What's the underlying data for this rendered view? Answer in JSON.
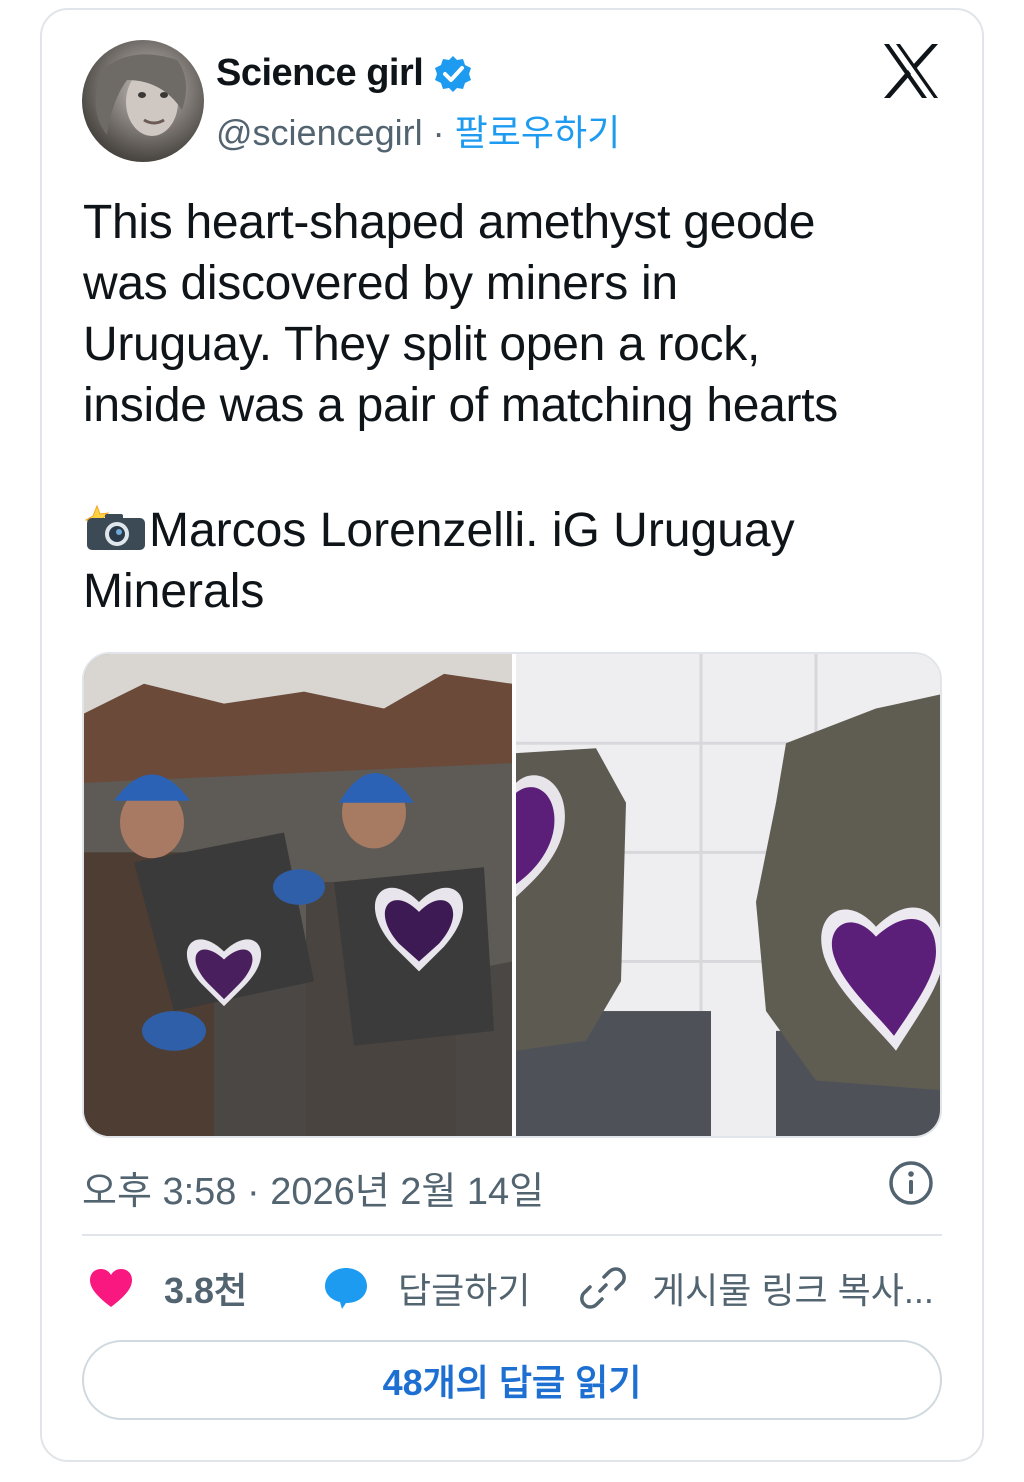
{
  "user": {
    "display_name": "Science girl",
    "handle": "@sciencegirl",
    "separator": " · ",
    "follow_label": "팔로우하기",
    "verified_icon": "verified-badge-icon",
    "brand_logo": "x-logo-icon"
  },
  "tweet": {
    "text_lines": [
      "This heart-shaped amethyst geode",
      "was discovered by miners in",
      "Uruguay. They split open a rock,",
      "inside was a pair of matching hearts"
    ],
    "credit_emoji_icon": "camera-flash-icon",
    "credit_line1": "Marcos Lorenzelli. iG Uruguay",
    "credit_line2": "Minerals"
  },
  "media": [
    {
      "description_icon": "miners-holding-geode-photo"
    },
    {
      "description_icon": "heart-geode-halves-photo"
    }
  ],
  "meta": {
    "timestamp": "오후 3:58 · 2026년 2월 14일",
    "info_icon": "info-icon"
  },
  "actions": {
    "like_count": "3.8천",
    "reply_label": "답글하기",
    "copy_link_label": "게시물 링크 복사..."
  },
  "read_replies_label": "48개의 답글 읽기",
  "colors": {
    "accent": "#1d9bf0",
    "like": "#f91880",
    "reply_icon": "#1d9bf0",
    "secondary_text": "#536471",
    "amethyst": "#5b1f7a"
  }
}
